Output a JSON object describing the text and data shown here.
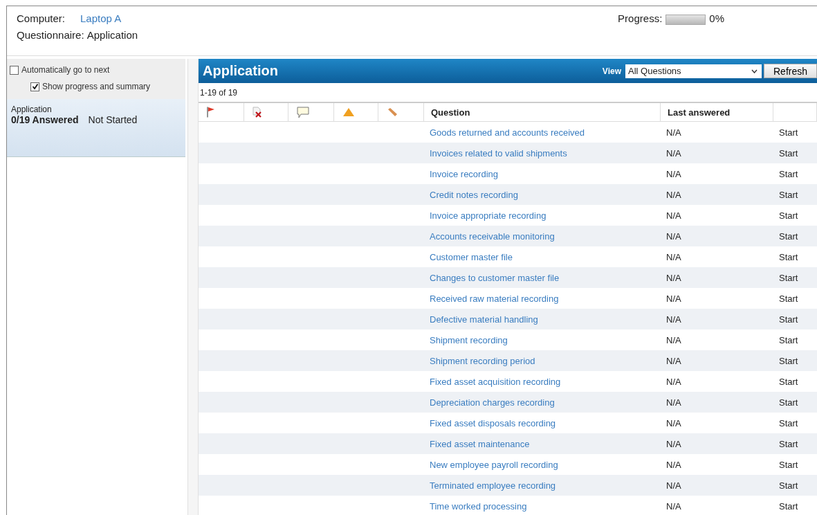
{
  "header": {
    "computer_label": "Computer:",
    "computer_value": "Laptop A",
    "questionnaire_label": "Questionnaire:",
    "questionnaire_value": "Application",
    "progress_label": "Progress:",
    "progress": {
      "level": 0
    },
    "progress_text": "0%"
  },
  "options": [
    {
      "label": "Automatically go to next",
      "checked": false
    },
    {
      "label": "Show progress and summary",
      "checked": true
    }
  ],
  "summary": {
    "title": "Application",
    "answered": "0/19 Answered",
    "status": "Not Started"
  },
  "panel": {
    "title": "Application",
    "view_label": "View",
    "view_value": "All Questions",
    "refresh": "Refresh",
    "count": "1-19 of 19"
  },
  "columns": [
    "Question",
    "Last answered"
  ],
  "rows": [
    {
      "question": "Goods returned and accounts received",
      "last_answered": "N/A",
      "action": "Start"
    },
    {
      "question": "Invoices related to valid shipments",
      "last_answered": "N/A",
      "action": "Start"
    },
    {
      "question": "Invoice recording",
      "last_answered": "N/A",
      "action": "Start"
    },
    {
      "question": "Credit notes recording",
      "last_answered": "N/A",
      "action": "Start"
    },
    {
      "question": "Invoice appropriate recording",
      "last_answered": "N/A",
      "action": "Start"
    },
    {
      "question": "Accounts receivable monitoring",
      "last_answered": "N/A",
      "action": "Start"
    },
    {
      "question": "Customer master file",
      "last_answered": "N/A",
      "action": "Start"
    },
    {
      "question": "Changes to customer master file",
      "last_answered": "N/A",
      "action": "Start"
    },
    {
      "question": "Received raw material recording",
      "last_answered": "N/A",
      "action": "Start"
    },
    {
      "question": "Defective material handling",
      "last_answered": "N/A",
      "action": "Start"
    },
    {
      "question": "Shipment recording",
      "last_answered": "N/A",
      "action": "Start"
    },
    {
      "question": "Shipment recording period",
      "last_answered": "N/A",
      "action": "Start"
    },
    {
      "question": "Fixed asset acquisition recording",
      "last_answered": "N/A",
      "action": "Start"
    },
    {
      "question": "Depreciation charges recording",
      "last_answered": "N/A",
      "action": "Start"
    },
    {
      "question": "Fixed asset disposals recording",
      "last_answered": "N/A",
      "action": "Start"
    },
    {
      "question": "Fixed asset maintenance",
      "last_answered": "N/A",
      "action": "Start"
    },
    {
      "question": "New employee payroll recording",
      "last_answered": "N/A",
      "action": "Start"
    },
    {
      "question": "Terminated employee recording",
      "last_answered": "N/A",
      "action": "Start"
    },
    {
      "question": "Time worked processing",
      "last_answered": "N/A",
      "action": "Start"
    }
  ]
}
